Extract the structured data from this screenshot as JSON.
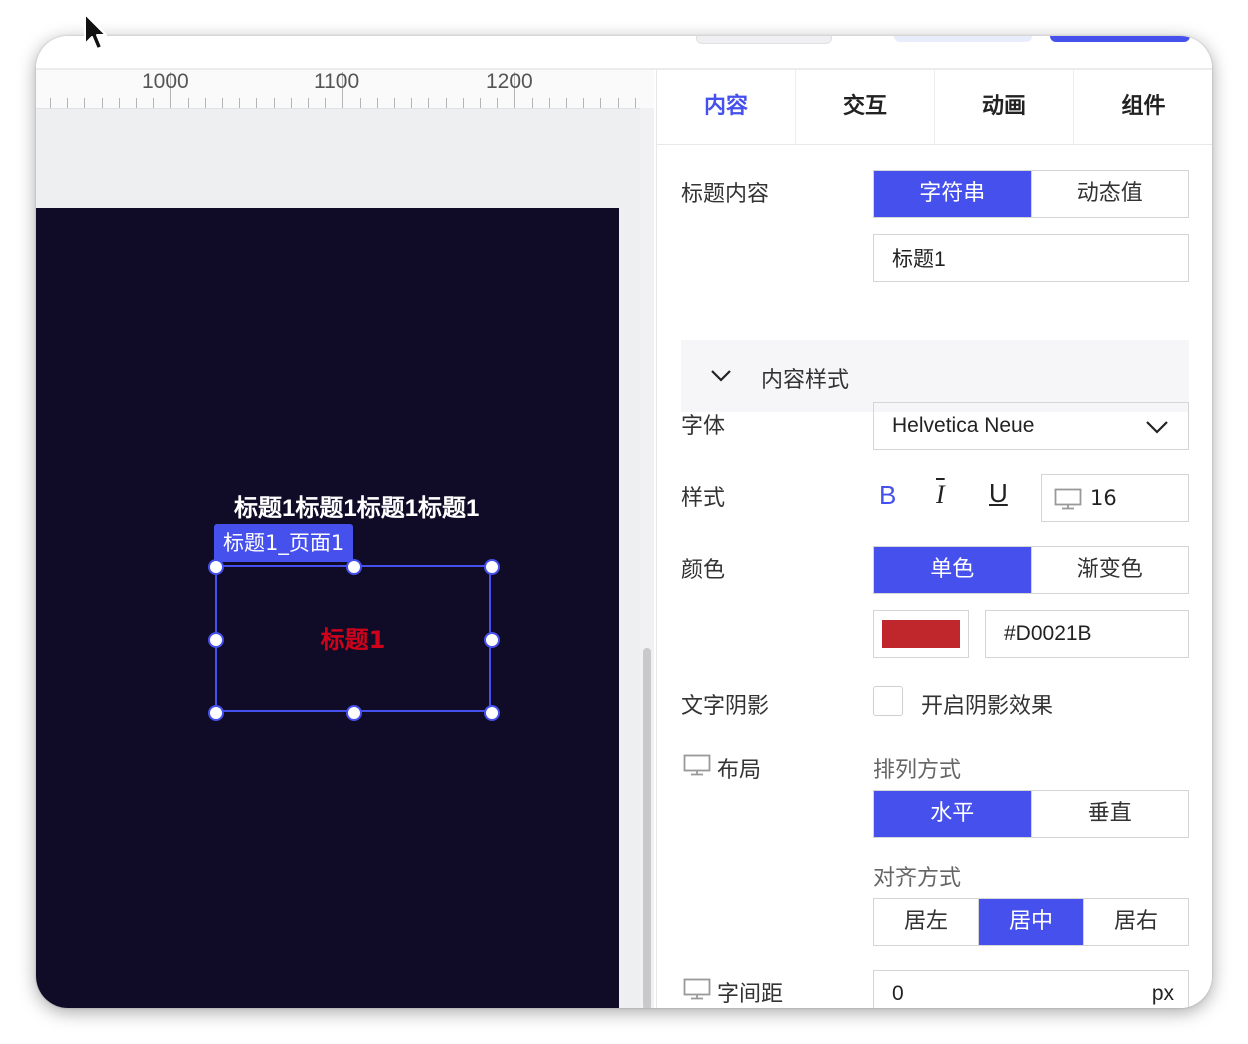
{
  "ruler": {
    "labels": [
      "1000",
      "1100",
      "1200"
    ]
  },
  "canvas": {
    "heading_text": "标题1标题1标题1标题1",
    "selection_tag": "标题1_页面1",
    "selected_text": "标题1",
    "selected_text_color": "#D0021B",
    "stage_color": "#100c27",
    "accent": "#4650ec"
  },
  "tabs": [
    {
      "label": "内容",
      "active": true
    },
    {
      "label": "交互",
      "active": false
    },
    {
      "label": "动画",
      "active": false
    },
    {
      "label": "组件",
      "active": false
    }
  ],
  "content": {
    "title_label": "标题内容",
    "type_options": [
      "字符串",
      "动态值"
    ],
    "type_selected": "字符串",
    "title_value": "标题1"
  },
  "style_section": {
    "label": "内容样式",
    "icon": "chevron-down-icon"
  },
  "font": {
    "label": "字体",
    "value": "Helvetica Neue"
  },
  "text_style": {
    "label": "样式",
    "bold": "B",
    "italic": "I",
    "underline": "U",
    "size": "16"
  },
  "color": {
    "label": "颜色",
    "options": [
      "单色",
      "渐变色"
    ],
    "selected": "单色",
    "hex": "#D0021B",
    "swatch": "#c0272d"
  },
  "shadow": {
    "label": "文字阴影",
    "checkbox_label": "开启阴影效果",
    "checked": false
  },
  "layout": {
    "label": "布局",
    "arrange_label": "排列方式",
    "arrange_options": [
      "水平",
      "垂直"
    ],
    "arrange_selected": "水平",
    "align_label": "对齐方式",
    "align_options": [
      "居左",
      "居中",
      "居右"
    ],
    "align_selected": "居中"
  },
  "spacing": {
    "label": "字间距",
    "value": "0",
    "unit": "px"
  }
}
